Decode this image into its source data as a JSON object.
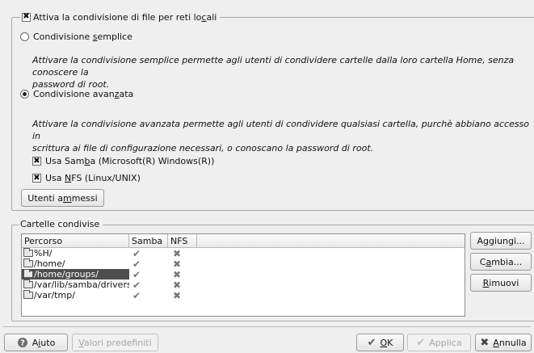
{
  "file_sharing": {
    "enable_label_pre": "Attiva la condivisione di file per reti lo",
    "enable_label_key": "c",
    "enable_label_post": "ali",
    "enable_checked": "✖",
    "simple": {
      "label_pre": "Condivisione ",
      "label_key": "s",
      "label_post": "emplice",
      "selected": false,
      "desc_line1": "Attivare la condivisione semplice permette agli utenti di condividere cartelle dalla loro cartella Home, senza conoscere la",
      "desc_line2": "password di root."
    },
    "advanced": {
      "label_pre": "Condivisione avan",
      "label_key": "z",
      "label_post": "ata",
      "selected": true,
      "desc_line1": "Attivare la condivisione avanzata permette agli utenti di condividere qualsiasi cartella, purchè abbiano accesso in",
      "desc_line2": "scrittura ai file di configurazione necessari, o conoscano la password di root."
    },
    "samba": {
      "label_pre": "Usa Sam",
      "label_key": "b",
      "label_post": "a (Microsoft(R) Windows(R))",
      "mark": "✖"
    },
    "nfs": {
      "label_pre": "Usa ",
      "label_key": "N",
      "label_post": "FS (Linux/UNIX)",
      "mark": "✖"
    },
    "allowed_users": {
      "label_pre": "Utenti a",
      "label_key": "m",
      "label_post": "messi"
    }
  },
  "shared_folders": {
    "title": "Cartelle condivise",
    "columns": {
      "path": "Percorso",
      "samba": "Samba",
      "nfs": "NFS"
    },
    "rows": [
      {
        "path": "%H/",
        "samba": "✔",
        "nfs": "✖"
      },
      {
        "path": "/home/",
        "samba": "✔",
        "nfs": "✖"
      },
      {
        "path": "/home/groups/",
        "samba": "✔",
        "nfs": "✖"
      },
      {
        "path": "/var/lib/samba/drivers/",
        "samba": "✔",
        "nfs": "✖"
      },
      {
        "path": "/var/tmp/",
        "samba": "✔",
        "nfs": "✖"
      }
    ],
    "selected_row": 2,
    "add": {
      "pre": "A",
      "key": "g",
      "post": "giungi..."
    },
    "change": {
      "pre": "C",
      "key": "a",
      "post": "mbia..."
    },
    "remove": {
      "pre": "",
      "key": "R",
      "post": "imuovi"
    }
  },
  "footer": {
    "help": {
      "pre": "A",
      "key": "i",
      "post": "uto"
    },
    "defaults": {
      "pre": "",
      "key": "V",
      "post": "alori predefiniti"
    },
    "ok": {
      "pre": "",
      "key": "O",
      "post": "K"
    },
    "apply": "Applica",
    "cancel": {
      "pre": "",
      "key": "A",
      "post": "nnulla"
    }
  }
}
